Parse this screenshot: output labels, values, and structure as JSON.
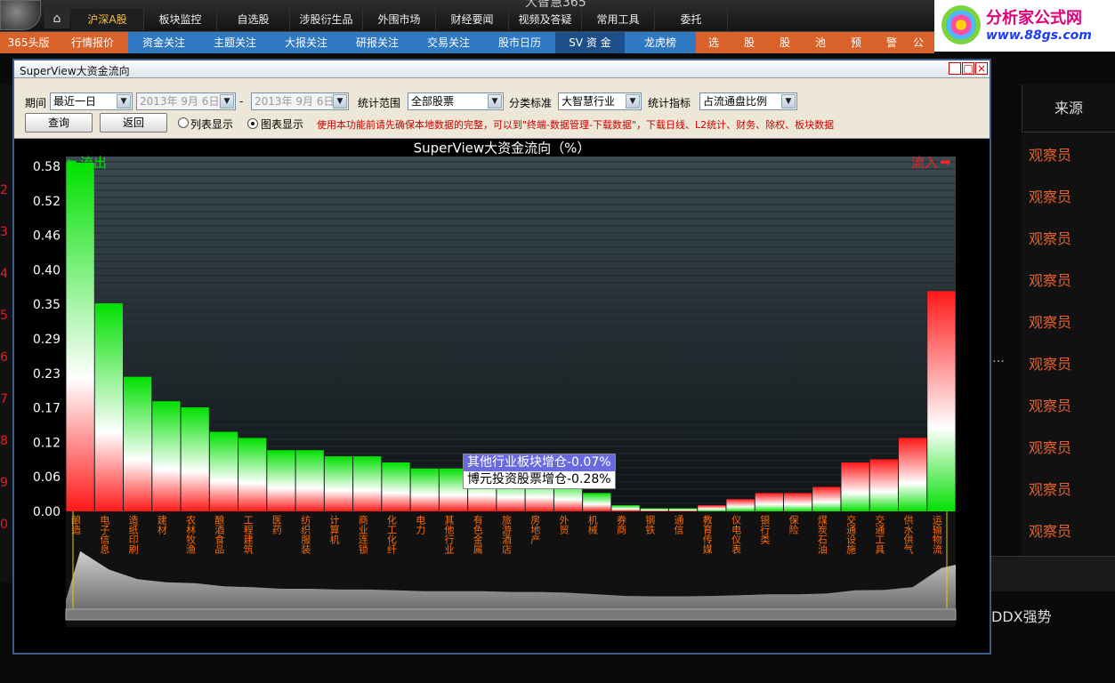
{
  "menu": {
    "home_icon": "home-icon",
    "tabs": [
      {
        "label": "沪深A股",
        "active": true
      },
      {
        "label": "板块监控"
      },
      {
        "label": "自选股"
      },
      {
        "label": "涉股衍生品"
      },
      {
        "label": "外围市场"
      },
      {
        "label": "财经要闻"
      },
      {
        "label": "视频及答疑"
      },
      {
        "label": "常用工具"
      },
      {
        "label": "委托"
      }
    ],
    "sub_tabs": [
      "365头版",
      "行情报价",
      "资金关注",
      "主题关注",
      "大报关注",
      "研报关注",
      "交易关注",
      "股市日历",
      "SV 资 金",
      "龙虎榜",
      "选",
      "股",
      "股",
      "池",
      "预",
      "警",
      "公"
    ]
  },
  "brand": {
    "top_text": "大智慧365",
    "title": "分析家公式网",
    "url": "www.88gs.com"
  },
  "background": {
    "column_header": "来源",
    "sources": [
      "观察员",
      "观察员",
      "观察员",
      "观察员",
      "观察员",
      "观察员",
      "观察员",
      "观察员",
      "观察员",
      "观察员"
    ],
    "ellipsis": "…",
    "ddx_label": "DDX强势",
    "left_numbers": [
      "2",
      "3",
      "4",
      "5",
      "6",
      "7",
      "8",
      "9",
      "0"
    ]
  },
  "dialog": {
    "title": "SuperView大资金流向",
    "period_label": "期间",
    "period_value": "最近一日",
    "date_from": "2013年 9月 6日",
    "date_sep": "-",
    "date_to": "2013年 9月 6日",
    "range_label": "统计范围",
    "range_value": "全部股票",
    "class_label": "分类标准",
    "class_value": "大智慧行业",
    "metric_label": "统计指标",
    "metric_value": "占流通盘比例",
    "query_button": "查询",
    "back_button": "返回",
    "list_radio": "列表显示",
    "chart_radio": "图表显示",
    "notice": "使用本功能前请先确保本地数据的完整，可以到\"终端-数据管理-下载数据\"，下载日线、L2统计、财务、除权、板块数据",
    "tooltip_line1": "其他行业板块增仓-0.07%",
    "tooltip_line2": "博元投资股票增仓-0.28%"
  },
  "chart_data": {
    "type": "bar",
    "title": "SuperView大资金流向（%）",
    "outflow_label": "流出",
    "inflow_label": "流入",
    "yticks": [
      "0.58",
      "0.52",
      "0.46",
      "0.40",
      "0.35",
      "0.29",
      "0.23",
      "0.17",
      "0.12",
      "0.06",
      "0.00"
    ],
    "ylim": [
      0,
      0.58
    ],
    "colors": {
      "outflow": "#00e000",
      "inflow": "#ff1818",
      "mid": "#ffffff"
    },
    "categories": [
      "酿造",
      "电子信息",
      "造纸印刷",
      "建材",
      "农林牧渔",
      "酿酒食品",
      "工程建筑",
      "医药",
      "纺织服装",
      "计算机",
      "商业连锁",
      "化工化纤",
      "电力",
      "其他行业",
      "有色金属",
      "旅游酒店",
      "房地产",
      "外贸",
      "机械",
      "券商",
      "钢铁",
      "通信",
      "教育传媒",
      "仪电仪表",
      "银行类",
      "保险",
      "煤炭石油",
      "交通设施",
      "交通工具",
      "供水供气",
      "运输物流"
    ],
    "values": [
      0.57,
      0.34,
      0.22,
      0.18,
      0.17,
      0.13,
      0.12,
      0.1,
      0.1,
      0.09,
      0.09,
      0.08,
      0.07,
      0.07,
      0.07,
      0.06,
      0.06,
      0.05,
      0.03,
      0.01,
      0.005,
      0.005,
      0.01,
      0.02,
      0.03,
      0.03,
      0.04,
      0.08,
      0.085,
      0.12,
      0.36
    ],
    "directions": [
      "out",
      "out",
      "out",
      "out",
      "out",
      "out",
      "out",
      "out",
      "out",
      "out",
      "out",
      "out",
      "out",
      "out",
      "out",
      "out",
      "out",
      "out",
      "out",
      "out",
      "out",
      "out",
      "in",
      "in",
      "in",
      "in",
      "in",
      "in",
      "in",
      "in",
      "in"
    ],
    "grid": true
  }
}
